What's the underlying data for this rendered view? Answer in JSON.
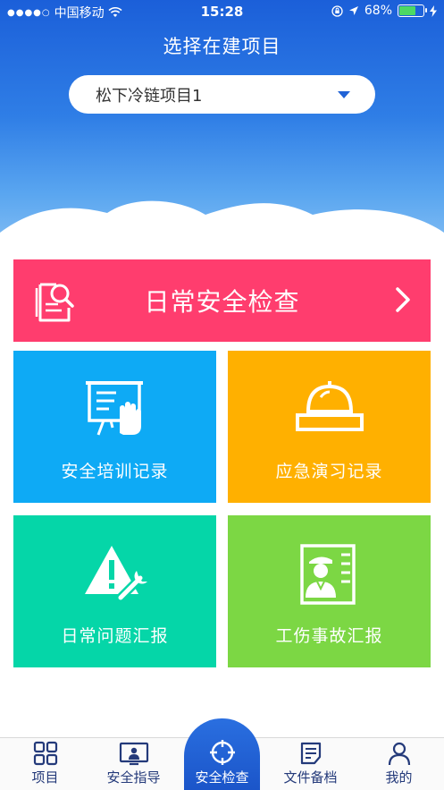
{
  "status_bar": {
    "carrier": "中国移动",
    "time": "15:28",
    "battery": "68%",
    "battery_level": 0.68
  },
  "header": {
    "title": "选择在建项目",
    "project_select": {
      "value": "松下冷链项目1"
    }
  },
  "banner": {
    "label": "日常安全检查",
    "color": "#ff3d6e"
  },
  "tiles": [
    {
      "label": "安全培训记录",
      "icon": "training-board-icon",
      "color": "#0eaaf5"
    },
    {
      "label": "应急演习记录",
      "icon": "emergency-siren-icon",
      "color": "#ffb000"
    },
    {
      "label": "日常问题汇报",
      "icon": "warning-wrench-icon",
      "color": "#05d6a8"
    },
    {
      "label": "工伤事故汇报",
      "icon": "injured-worker-icon",
      "color": "#7cd744"
    }
  ],
  "tabbar": {
    "active_index": 2,
    "items": [
      {
        "label": "项目",
        "icon": "grid-icon"
      },
      {
        "label": "安全指导",
        "icon": "guide-screen-icon"
      },
      {
        "label": "安全检查",
        "icon": "crosshair-icon"
      },
      {
        "label": "文件备档",
        "icon": "document-icon"
      },
      {
        "label": "我的",
        "icon": "user-icon"
      }
    ]
  }
}
